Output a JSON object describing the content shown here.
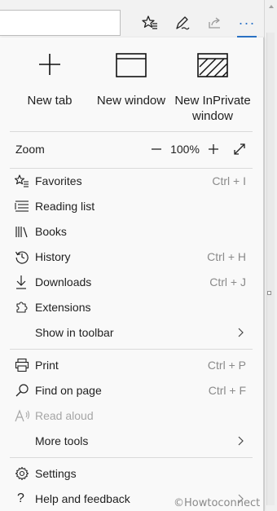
{
  "toolbar": {
    "buttons": [
      {
        "name": "favorites-star-icon"
      },
      {
        "name": "notes-pen-icon"
      },
      {
        "name": "share-icon"
      },
      {
        "name": "more-dots-icon"
      }
    ],
    "more_label": "···"
  },
  "menu": {
    "tiles": [
      {
        "label": "New tab",
        "icon": "plus-icon"
      },
      {
        "label": "New window",
        "icon": "window-icon"
      },
      {
        "label": "New InPrivate window",
        "icon": "inprivate-window-icon"
      }
    ],
    "zoom": {
      "label": "Zoom",
      "minus": "−",
      "value": "100%",
      "plus": "+",
      "fullscreen_icon": "fullscreen-icon"
    },
    "group1": [
      {
        "label": "Favorites",
        "shortcut": "Ctrl + I",
        "icon": "favorites-icon"
      },
      {
        "label": "Reading list",
        "shortcut": "",
        "icon": "reading-list-icon"
      },
      {
        "label": "Books",
        "shortcut": "",
        "icon": "books-icon"
      },
      {
        "label": "History",
        "shortcut": "Ctrl + H",
        "icon": "history-icon"
      },
      {
        "label": "Downloads",
        "shortcut": "Ctrl + J",
        "icon": "download-icon"
      },
      {
        "label": "Extensions",
        "shortcut": "",
        "icon": "extensions-icon"
      },
      {
        "label": "Show in toolbar",
        "shortcut": "",
        "icon": "",
        "submenu": true
      }
    ],
    "group2": [
      {
        "label": "Print",
        "shortcut": "Ctrl + P",
        "icon": "print-icon"
      },
      {
        "label": "Find on page",
        "shortcut": "Ctrl + F",
        "icon": "search-icon"
      },
      {
        "label": "Read aloud",
        "shortcut": "",
        "icon": "read-aloud-icon",
        "disabled": true
      },
      {
        "label": "More tools",
        "shortcut": "",
        "icon": "",
        "submenu": true
      }
    ],
    "group3": [
      {
        "label": "Settings",
        "shortcut": "",
        "icon": "gear-icon"
      },
      {
        "label": "Help and feedback",
        "shortcut": "",
        "icon": "help-icon",
        "submenu": true
      }
    ]
  },
  "watermark": "©Howtoconnect",
  "colors": {
    "accent": "#2b73c7",
    "text": "#1f1f1f",
    "muted": "#8a8a8a",
    "disabled": "#a6a6a6"
  }
}
